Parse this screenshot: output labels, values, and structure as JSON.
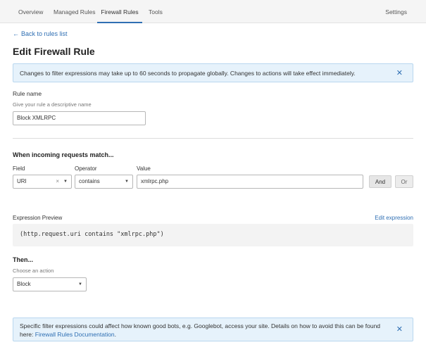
{
  "nav": {
    "tabs": [
      {
        "label": "Overview"
      },
      {
        "label": "Managed Rules"
      },
      {
        "label": "Firewall Rules"
      },
      {
        "label": "Tools"
      }
    ],
    "settings_label": "Settings",
    "active_tab": "Firewall Rules"
  },
  "back_link": {
    "arrow": "←",
    "label": "Back to rules list"
  },
  "title": "Edit Firewall Rule",
  "notice_top": {
    "text": "Changes to filter expressions may take up to 60 seconds to propagate globally. Changes to actions will take effect immediately.",
    "close": "✕"
  },
  "rule_name": {
    "label": "Rule name",
    "hint": "Give your rule a descriptive name",
    "value": "Block XMLRPC"
  },
  "match": {
    "heading": "When incoming requests match...",
    "field_label": "Field",
    "operator_label": "Operator",
    "value_label": "Value",
    "field_value": "URI",
    "field_clear": "×",
    "operator_value": "contains",
    "value": "xmlrpc.php",
    "caret": "▼",
    "and_label": "And",
    "or_label": "Or"
  },
  "expression": {
    "label": "Expression Preview",
    "edit_label": "Edit expression",
    "code": "(http.request.uri contains \"xmlrpc.php\")"
  },
  "action": {
    "heading": "Then...",
    "hint": "Choose an action",
    "value": "Block"
  },
  "notice_bottom": {
    "text": "Specific filter expressions could affect how known good bots, e.g. Googlebot, access your site. Details on how to avoid this can be found here: ",
    "link": "Firewall Rules Documentation",
    "suffix": ".",
    "close": "✕"
  },
  "colors": {
    "accent": "#2f6fb3",
    "notice_bg": "#e6f2fb",
    "nav_bg": "#f5f5f5"
  }
}
